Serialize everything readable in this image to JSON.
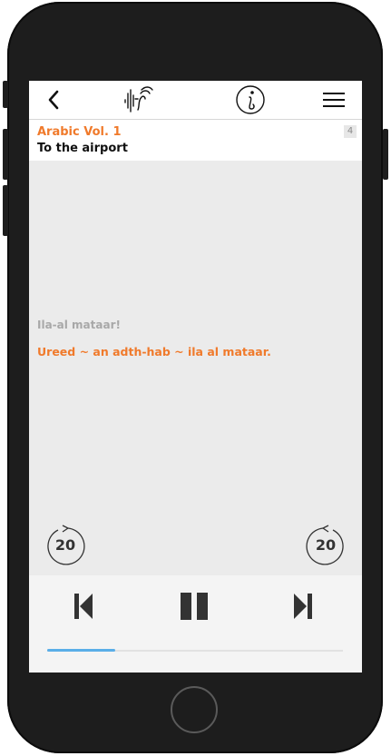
{
  "toolbar": {
    "back_icon": "chevron-left-icon",
    "logo_icon": "soundwave-speaker-logo",
    "info_icon": "info-icon",
    "menu_icon": "hamburger-menu-icon"
  },
  "header": {
    "volume": "Arabic Vol. 1",
    "lesson": "To the airport",
    "lesson_number": "4"
  },
  "content": {
    "phrase_native": "Ila-al mataar!",
    "phrase_target": "Ureed ~ an adth-hab ~ ila al mataar."
  },
  "skip": {
    "back_label": "20",
    "forward_label": "20"
  },
  "player": {
    "prev_icon": "skip-previous-icon",
    "pause_icon": "pause-icon",
    "next_icon": "skip-next-icon",
    "progress": 0.23
  },
  "colors": {
    "accent": "#f07a2b",
    "progress": "#5aaee8",
    "phrase_native": "#a8a8a8"
  }
}
